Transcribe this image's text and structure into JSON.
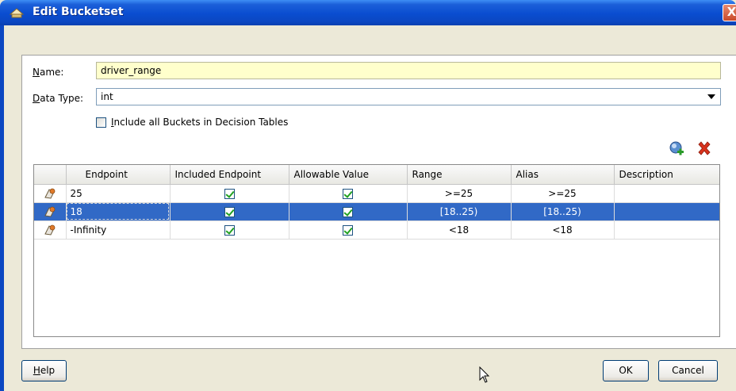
{
  "window": {
    "title": "Edit Bucketset",
    "close_glyph": "X"
  },
  "form": {
    "name_label": "Name:",
    "name_value": "driver_range",
    "type_label": "Data Type:",
    "type_value": "int",
    "include_label": "Include all Buckets in Decision Tables",
    "include_checked": false
  },
  "table": {
    "columns": [
      "Endpoint",
      "Included Endpoint",
      "Allowable Value",
      "Range",
      "Alias",
      "Description"
    ],
    "rows": [
      {
        "endpoint": "25",
        "included": true,
        "allowable": true,
        "range": ">=25",
        "alias": ">=25",
        "description": "",
        "selected": false
      },
      {
        "endpoint": "18",
        "included": true,
        "allowable": true,
        "range": "[18..25)",
        "alias": "[18..25)",
        "description": "",
        "selected": true
      },
      {
        "endpoint": "-Infinity",
        "included": true,
        "allowable": true,
        "range": "<18",
        "alias": "<18",
        "description": "",
        "selected": false
      }
    ]
  },
  "buttons": {
    "help": "Help",
    "ok": "OK",
    "cancel": "Cancel"
  },
  "icons": {
    "title": "bucketset-icon",
    "add": "add-bucket-icon",
    "delete": "delete-bucket-icon",
    "row": "bucket-row-icon",
    "pointer": "mouse-cursor-icon"
  },
  "colors": {
    "titlebar": "#0a4dd0",
    "selection": "#3169c6",
    "name_field_bg": "#ffffcc",
    "delete": "#d8321c",
    "add": "#2a9a2a"
  }
}
